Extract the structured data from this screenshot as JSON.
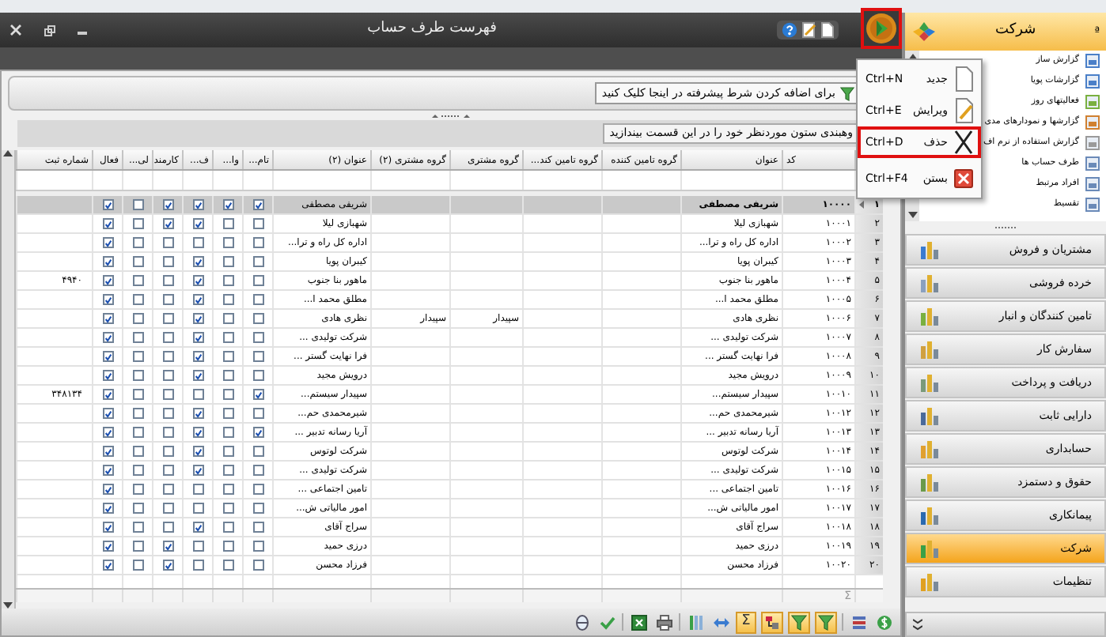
{
  "window": {
    "title": "فهرست طرف حساب"
  },
  "context_menu": [
    {
      "kind": "new",
      "label": "جدید",
      "shortcut": "Ctrl+N",
      "selected": false
    },
    {
      "kind": "edit",
      "label": "ویرایش",
      "shortcut": "Ctrl+E",
      "selected": false
    },
    {
      "kind": "delete",
      "label": "حذف",
      "shortcut": "Ctrl+D",
      "selected": true
    },
    {
      "kind": "close",
      "label": "بستن",
      "shortcut": "Ctrl+F4",
      "selected": false
    }
  ],
  "filter_bar": {
    "label": "برای اضافه کردن شرط پیشرفته در اینجا کلیک کنید"
  },
  "group_area": {
    "hint": "وهبندی ستون موردنظر خود را در این قسمت بیندازید"
  },
  "table": {
    "columns": [
      "کد",
      "عنوان",
      "گروه تامین کننده",
      "گروه تامین کند...",
      "گروه مشتری",
      "گروه مشتری (۲)",
      "عنوان (۲)",
      "تام...",
      "وا...",
      "ف...",
      "کارمند",
      "لی...",
      "فعال",
      "شماره ثبت"
    ],
    "rows": [
      {
        "index": "۱",
        "selected": true,
        "code": "۱۰۰۰۰",
        "title": "شریفی مصطفی",
        "title_2": "شریفی مصطفی",
        "flags": [
          true,
          true,
          true,
          true,
          false,
          true
        ]
      },
      {
        "index": "۲",
        "selected": false,
        "code": "۱۰۰۰۱",
        "title": "شهبازی لیلا",
        "title_2": "شهبازی لیلا",
        "flags": [
          false,
          false,
          true,
          true,
          false,
          true
        ]
      },
      {
        "index": "۳",
        "selected": false,
        "code": "۱۰۰۰۲",
        "title": "اداره کل راه و ترا...",
        "title_2": "اداره کل راه و ترا...",
        "flags": [
          false,
          false,
          false,
          false,
          false,
          true
        ]
      },
      {
        "index": "۴",
        "selected": false,
        "code": "۱۰۰۰۳",
        "title": "کیبران پویا",
        "title_2": "کیبران پویا",
        "flags": [
          false,
          false,
          true,
          false,
          false,
          true
        ]
      },
      {
        "index": "۵",
        "selected": false,
        "code": "۱۰۰۰۴",
        "title": "ماهور بنا جنوب",
        "title_2": "ماهور بنا جنوب",
        "flags": [
          false,
          false,
          true,
          false,
          false,
          true
        ],
        "reg_no": "۴۹۴۰"
      },
      {
        "index": "۶",
        "selected": false,
        "code": "۱۰۰۰۵",
        "title": "مطلق محمد ا...",
        "title_2": "مطلق محمد ا...",
        "flags": [
          false,
          false,
          true,
          false,
          false,
          true
        ]
      },
      {
        "index": "۷",
        "selected": false,
        "code": "۱۰۰۰۶",
        "title": "نظری هادی",
        "title_2": "نظری هادی",
        "customer_group": "سپیدار",
        "customer_group_2": "سپیدار",
        "flags": [
          false,
          false,
          true,
          false,
          false,
          true
        ]
      },
      {
        "index": "۸",
        "selected": false,
        "code": "۱۰۰۰۷",
        "title": "شرکت تولیدی ...",
        "title_2": "شرکت تولیدی ...",
        "flags": [
          false,
          false,
          true,
          false,
          false,
          true
        ]
      },
      {
        "index": "۹",
        "selected": false,
        "code": "۱۰۰۰۸",
        "title": "فرا نهایت گستر ...",
        "title_2": "فرا نهایت گستر ...",
        "flags": [
          false,
          false,
          true,
          false,
          false,
          true
        ]
      },
      {
        "index": "۱۰",
        "selected": false,
        "code": "۱۰۰۰۹",
        "title": "درویش مجید",
        "title_2": "درویش مجید",
        "flags": [
          false,
          false,
          true,
          false,
          false,
          true
        ]
      },
      {
        "index": "۱۱",
        "selected": false,
        "code": "۱۰۰۱۰",
        "title": "سپیدار سیستم...",
        "title_2": "سپیدار سیستم...",
        "flags": [
          true,
          false,
          false,
          false,
          false,
          true
        ],
        "reg_no": "۳۴۸۱۳۴"
      },
      {
        "index": "۱۲",
        "selected": false,
        "code": "۱۰۰۱۲",
        "title": "شیرمحمدی حم...",
        "title_2": "شیرمحمدی حم...",
        "flags": [
          false,
          false,
          true,
          false,
          false,
          true
        ]
      },
      {
        "index": "۱۳",
        "selected": false,
        "code": "۱۰۰۱۳",
        "title": "آریا رسانه تدبیر ...",
        "title_2": "آریا رسانه تدبیر ...",
        "flags": [
          true,
          false,
          true,
          false,
          false,
          true
        ]
      },
      {
        "index": "۱۴",
        "selected": false,
        "code": "۱۰۰۱۴",
        "title": "شرکت لوتوس",
        "title_2": "شرکت لوتوس",
        "flags": [
          false,
          false,
          true,
          false,
          false,
          true
        ]
      },
      {
        "index": "۱۵",
        "selected": false,
        "code": "۱۰۰۱۵",
        "title": "شرکت تولیدی ...",
        "title_2": "شرکت تولیدی ...",
        "flags": [
          false,
          false,
          true,
          false,
          false,
          true
        ]
      },
      {
        "index": "۱۶",
        "selected": false,
        "code": "۱۰۰۱۶",
        "title": "تامین اجتماعی ...",
        "title_2": "تامین اجتماعی ...",
        "flags": [
          false,
          false,
          false,
          false,
          false,
          true
        ]
      },
      {
        "index": "۱۷",
        "selected": false,
        "code": "۱۰۰۱۷",
        "title": "امور مالیاتی ش...",
        "title_2": "امور مالیاتی ش...",
        "flags": [
          false,
          false,
          false,
          false,
          false,
          true
        ]
      },
      {
        "index": "۱۸",
        "selected": false,
        "code": "۱۰۰۱۸",
        "title": "سراج آقای",
        "title_2": "سراج آقای",
        "flags": [
          false,
          false,
          true,
          false,
          false,
          true
        ]
      },
      {
        "index": "۱۹",
        "selected": false,
        "code": "۱۰۰۱۹",
        "title": "درزی حمید",
        "title_2": "درزی حمید",
        "flags": [
          false,
          false,
          false,
          true,
          false,
          true
        ]
      },
      {
        "index": "۲۰",
        "selected": false,
        "code": "۱۰۰۲۰",
        "title": "فرزاد محسن",
        "title_2": "فرزاد محسن",
        "flags": [
          false,
          false,
          false,
          true,
          false,
          true
        ]
      }
    ],
    "footer": {
      "sum_symbol": "Σ"
    }
  },
  "toolbar": [
    {
      "kind": "dollar",
      "on": false
    },
    {
      "kind": "list",
      "on": false
    },
    {
      "kind": "filter",
      "on": true
    },
    {
      "kind": "filter",
      "on": true
    },
    {
      "kind": "group",
      "on": true
    },
    {
      "kind": "sum",
      "on": true,
      "label": "Σ"
    },
    {
      "kind": "arrows",
      "on": false
    },
    {
      "kind": "columns",
      "on": false
    },
    {
      "kind": "print",
      "on": false
    },
    {
      "kind": "excel",
      "on": false
    },
    {
      "kind": "check",
      "on": false
    },
    {
      "kind": "ellipse",
      "on": false
    }
  ],
  "sidebar": {
    "title": "شرکت",
    "pin": "ª",
    "items": [
      "گزارش ساز",
      "گزارشات پویا",
      "فعالیتهای روز",
      "گزارشها و نمودارهای مدی",
      "گزارش استفاده از نرم اف",
      "طرف حساب ها",
      "افراد مرتبط",
      "تقسیط"
    ],
    "modules": [
      {
        "label": "مشتریان و فروش",
        "selected": false
      },
      {
        "label": "خرده فروشی",
        "selected": false
      },
      {
        "label": "تامین کنندگان و انبار",
        "selected": false
      },
      {
        "label": "سفارش کار",
        "selected": false
      },
      {
        "label": "دریافت و پرداخت",
        "selected": false
      },
      {
        "label": "دارایی ثابت",
        "selected": false
      },
      {
        "label": "حسابداری",
        "selected": false
      },
      {
        "label": "حقوق و دستمزد",
        "selected": false
      },
      {
        "label": "پیمانکاری",
        "selected": false
      },
      {
        "label": "شرکت",
        "selected": true
      },
      {
        "label": "تنظیمات",
        "selected": false
      }
    ]
  }
}
